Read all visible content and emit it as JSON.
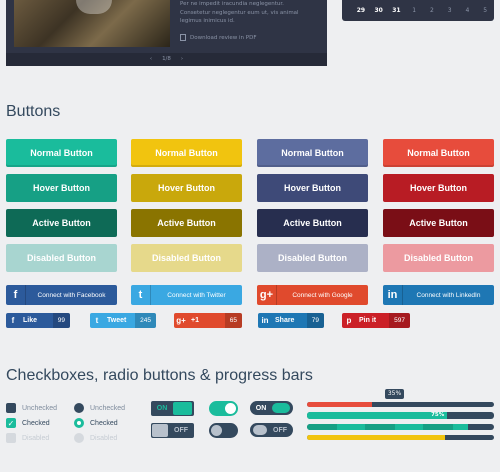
{
  "preview": {
    "description_lines": [
      "Per ne impedit iracundia neglegentur.",
      "Consetetur neglegentur eum ut, vis animal",
      "legimus inimicus id."
    ],
    "pdf_link": "Download review in PDF",
    "pager": "1/8",
    "calendar_days": [
      {
        "d": "29",
        "bold": true
      },
      {
        "d": "30",
        "bold": true
      },
      {
        "d": "31",
        "bold": true
      },
      {
        "d": "1",
        "bold": false
      },
      {
        "d": "2",
        "bold": false
      },
      {
        "d": "3",
        "bold": false
      },
      {
        "d": "4",
        "bold": false
      },
      {
        "d": "5",
        "bold": false
      }
    ]
  },
  "buttons_section": {
    "title": "Buttons",
    "rows": [
      {
        "label": "Normal Button",
        "colors": [
          "#1abc9c",
          "#f1c40f",
          "#5d6d9f",
          "#e74c3c"
        ]
      },
      {
        "label": "Hover Button",
        "colors": [
          "#16a085",
          "#c9a80c",
          "#3e4a78",
          "#b81c24"
        ]
      },
      {
        "label": "Active Button",
        "colors": [
          "#0e6a56",
          "#8a7400",
          "#272e4f",
          "#7a0e16"
        ]
      },
      {
        "label": "Disabled Button",
        "colors": [
          "#a8d5d0",
          "#e6d98b",
          "#acb1c6",
          "#ec9aa0"
        ]
      }
    ],
    "social": [
      {
        "icon": "f",
        "label": "Connect with Facebook",
        "color": "#2c5a9b"
      },
      {
        "icon": "t",
        "label": "Connect with Twitter",
        "color": "#3aa8e2"
      },
      {
        "icon": "g+",
        "label": "Connect with Google",
        "color": "#e04a2d"
      },
      {
        "icon": "in",
        "label": "Connect with LinkedIn",
        "color": "#1e77b4"
      }
    ],
    "share": [
      {
        "icon": "f",
        "label": "Like",
        "count": "99",
        "color": "#2c5a9b"
      },
      {
        "icon": "t",
        "label": "Tweet",
        "count": "245",
        "color": "#3aa8e2"
      },
      {
        "icon": "g+",
        "label": "+1",
        "count": "65",
        "color": "#e04a2d"
      },
      {
        "icon": "in",
        "label": "Share",
        "count": "79",
        "color": "#1e77b4"
      },
      {
        "icon": "p",
        "label": "Pin it",
        "count": "597",
        "color": "#cb2027"
      }
    ]
  },
  "checks_section": {
    "title": "Checkboxes, radio buttons & progress bars",
    "checkbox_unchecked": "Unchecked",
    "checkbox_checked": "Checked",
    "checkbox_disabled": "Disabled",
    "radio_unchecked": "Unchecked",
    "radio_checked": "Checked",
    "radio_disabled": "Disabled",
    "toggle_on": "ON",
    "toggle_off": "OFF",
    "pill_on": "ON",
    "pill_off": "OFF",
    "progress_tooltip": "35%",
    "progress_label": "75%",
    "progress": [
      {
        "value": 0.35,
        "color": "#e74c3c"
      },
      {
        "value": 0.75,
        "color": "#1abc9c"
      },
      {
        "value": 0.86,
        "color": "#16a085"
      },
      {
        "value": 0.74,
        "color": "#f1c40f"
      }
    ],
    "colors": {
      "dark": "#34495e",
      "teal": "#1abc9c",
      "muted": "#b8c1cc"
    }
  }
}
